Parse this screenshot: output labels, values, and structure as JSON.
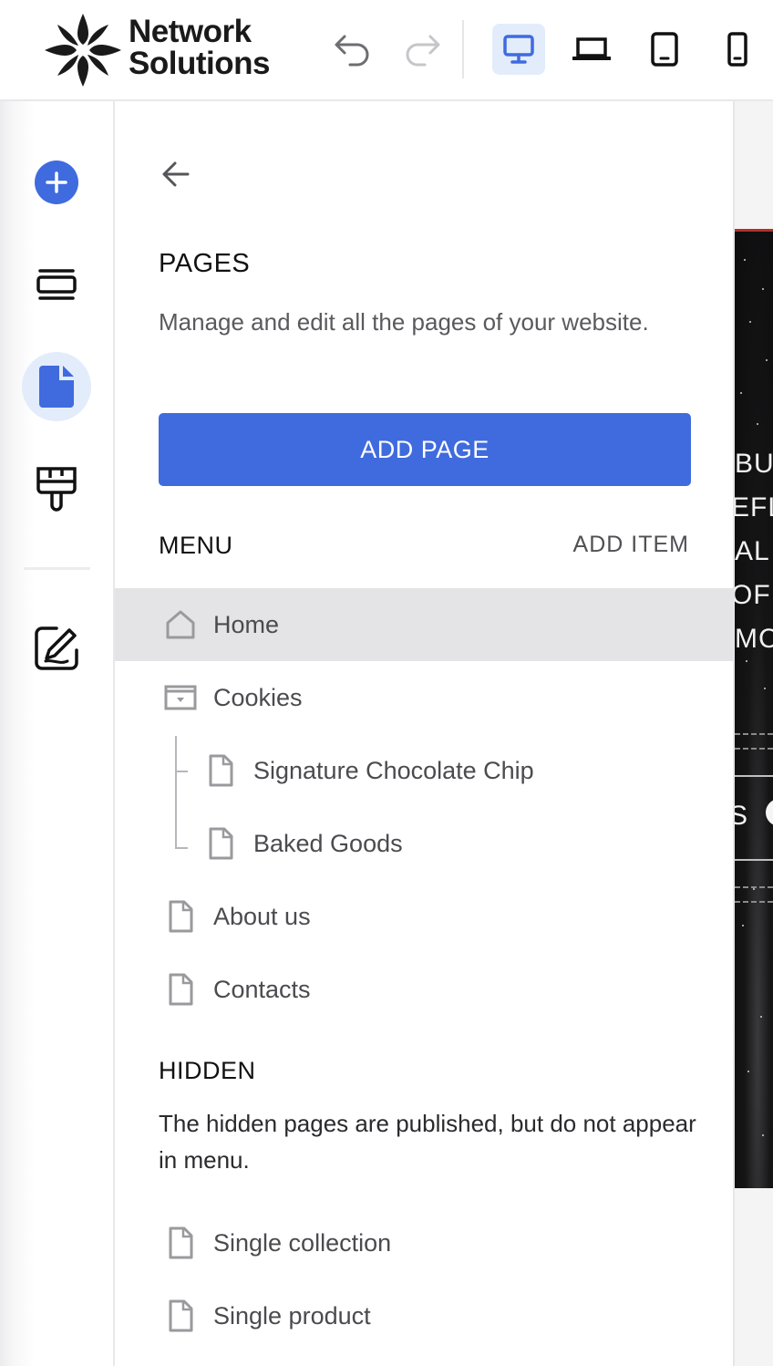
{
  "brand": {
    "line1": "Network",
    "line2": "Solutions"
  },
  "toolbar": {
    "undo_icon": "undo-icon",
    "redo_icon": "redo-icon",
    "devices": [
      "desktop-icon",
      "laptop-icon",
      "tablet-icon",
      "mobile-icon"
    ],
    "active_device": "desktop"
  },
  "rail": {
    "items": [
      "add-icon",
      "sections-icon",
      "pages-icon",
      "design-brush-icon",
      "edit-icon"
    ],
    "active": "pages-icon"
  },
  "panel": {
    "title": "PAGES",
    "description": "Manage and edit all the pages of your website.",
    "add_page_label": "ADD PAGE",
    "menu_title": "MENU",
    "add_item_label": "ADD ITEM",
    "menu_items": [
      {
        "label": "Home",
        "icon": "home-icon",
        "selected": true
      },
      {
        "label": "Cookies",
        "icon": "folder-dropdown-icon"
      },
      {
        "label": "Signature Chocolate Chip",
        "icon": "page-icon",
        "child": true
      },
      {
        "label": "Baked Goods",
        "icon": "page-icon",
        "child": true
      },
      {
        "label": "About us",
        "icon": "page-icon"
      },
      {
        "label": "Contacts",
        "icon": "page-icon"
      }
    ],
    "hidden_title": "HIDDEN",
    "hidden_description": "The hidden pages are published, but do not appear in menu.",
    "hidden_items": [
      {
        "label": "Single collection",
        "icon": "page-icon"
      },
      {
        "label": "Single product",
        "icon": "page-icon"
      }
    ]
  },
  "preview": {
    "text_fragments": [
      "BU",
      "EFL",
      "AL",
      "OF",
      "MC",
      "S"
    ]
  },
  "colors": {
    "accent": "#3f6bde",
    "active_bg": "#e3ecfb",
    "selected_row": "#e4e4e6"
  }
}
